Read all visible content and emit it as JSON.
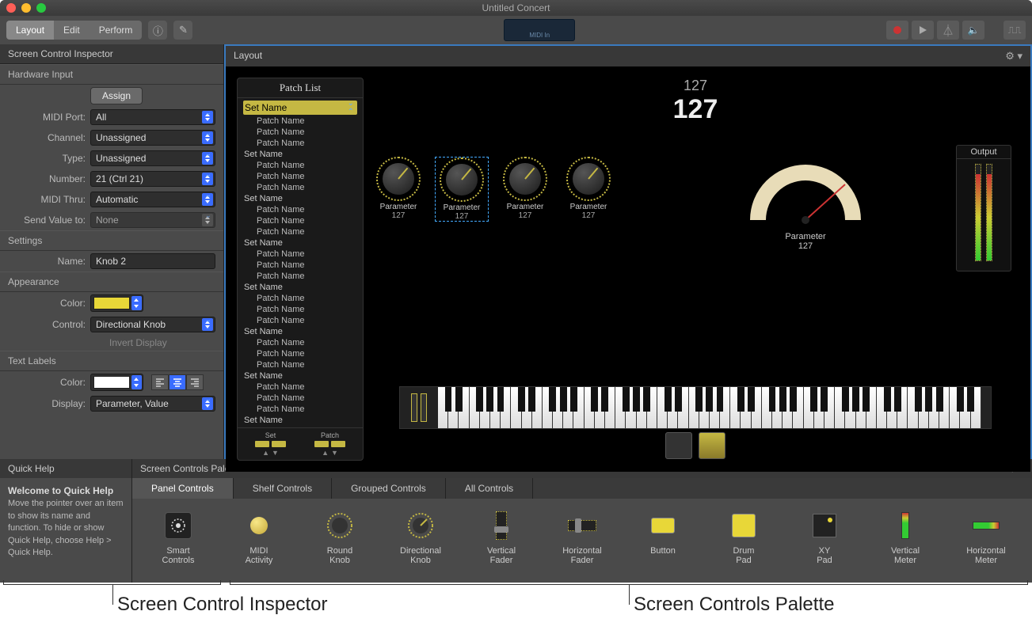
{
  "window_title": "Untitled Concert",
  "toolbar": {
    "modes": [
      "Layout",
      "Edit",
      "Perform"
    ],
    "active_mode": 0,
    "midi_in_label": "MIDI In"
  },
  "inspector": {
    "title": "Screen Control Inspector",
    "hardware_input": {
      "section": "Hardware Input",
      "assign_btn": "Assign",
      "midi_port_label": "MIDI Port:",
      "midi_port_value": "All",
      "channel_label": "Channel:",
      "channel_value": "Unassigned",
      "type_label": "Type:",
      "type_value": "Unassigned",
      "number_label": "Number:",
      "number_value": "21 (Ctrl 21)",
      "midi_thru_label": "MIDI Thru:",
      "midi_thru_value": "Automatic",
      "send_value_label": "Send Value to:",
      "send_value_value": "None"
    },
    "settings": {
      "section": "Settings",
      "name_label": "Name:",
      "name_value": "Knob 2"
    },
    "appearance": {
      "section": "Appearance",
      "color_label": "Color:",
      "color_value": "#e8d738",
      "control_label": "Control:",
      "control_value": "Directional Knob",
      "invert_label": "Invert Display"
    },
    "text_labels": {
      "section": "Text Labels",
      "color_label": "Color:",
      "color_value": "#ffffff",
      "display_label": "Display:",
      "display_value": "Parameter, Value"
    }
  },
  "layout_area": {
    "title": "Layout",
    "patch_list_title": "Patch List",
    "patch_tree": [
      {
        "type": "set",
        "label": "Set Name",
        "selected": true
      },
      {
        "type": "patch",
        "label": "Patch Name"
      },
      {
        "type": "patch",
        "label": "Patch Name"
      },
      {
        "type": "patch",
        "label": "Patch Name"
      },
      {
        "type": "set",
        "label": "Set Name"
      },
      {
        "type": "patch",
        "label": "Patch Name"
      },
      {
        "type": "patch",
        "label": "Patch Name"
      },
      {
        "type": "patch",
        "label": "Patch Name"
      },
      {
        "type": "set",
        "label": "Set Name"
      },
      {
        "type": "patch",
        "label": "Patch Name"
      },
      {
        "type": "patch",
        "label": "Patch Name"
      },
      {
        "type": "patch",
        "label": "Patch Name"
      },
      {
        "type": "set",
        "label": "Set Name"
      },
      {
        "type": "patch",
        "label": "Patch Name"
      },
      {
        "type": "patch",
        "label": "Patch Name"
      },
      {
        "type": "patch",
        "label": "Patch Name"
      },
      {
        "type": "set",
        "label": "Set Name"
      },
      {
        "type": "patch",
        "label": "Patch Name"
      },
      {
        "type": "patch",
        "label": "Patch Name"
      },
      {
        "type": "patch",
        "label": "Patch Name"
      },
      {
        "type": "set",
        "label": "Set Name"
      },
      {
        "type": "patch",
        "label": "Patch Name"
      },
      {
        "type": "patch",
        "label": "Patch Name"
      },
      {
        "type": "patch",
        "label": "Patch Name"
      },
      {
        "type": "set",
        "label": "Set Name"
      },
      {
        "type": "patch",
        "label": "Patch Name"
      },
      {
        "type": "patch",
        "label": "Patch Name"
      },
      {
        "type": "patch",
        "label": "Patch Name"
      },
      {
        "type": "set",
        "label": "Set Name"
      }
    ],
    "patch_btns": {
      "set_label": "Set",
      "patch_label": "Patch"
    },
    "big_number_small": "127",
    "big_number_large": "127",
    "knobs": [
      {
        "label": "Parameter",
        "value": "127",
        "selected": false
      },
      {
        "label": "Parameter",
        "value": "127",
        "selected": true
      },
      {
        "label": "Parameter",
        "value": "127",
        "selected": false
      },
      {
        "label": "Parameter",
        "value": "127",
        "selected": false
      }
    ],
    "meter": {
      "label": "Parameter",
      "value": "127"
    },
    "output_label": "Output"
  },
  "quickhelp": {
    "title": "Quick Help",
    "heading": "Welcome to Quick Help",
    "body": "Move the pointer over an item to show its name and function. To hide or show Quick Help, choose Help > Quick Help."
  },
  "palette": {
    "title": "Screen Controls Palette",
    "tabs": [
      "Panel Controls",
      "Shelf Controls",
      "Grouped Controls",
      "All Controls"
    ],
    "active_tab": 0,
    "items": [
      {
        "name": "Smart Controls"
      },
      {
        "name": "MIDI Activity"
      },
      {
        "name": "Round Knob"
      },
      {
        "name": "Directional Knob"
      },
      {
        "name": "Vertical Fader"
      },
      {
        "name": "Horizontal Fader"
      },
      {
        "name": "Button"
      },
      {
        "name": "Drum Pad"
      },
      {
        "name": "XY Pad"
      },
      {
        "name": "Vertical Meter"
      },
      {
        "name": "Horizontal Meter"
      }
    ]
  },
  "annotations": {
    "left": "Screen Control Inspector",
    "right": "Screen Controls Palette"
  }
}
